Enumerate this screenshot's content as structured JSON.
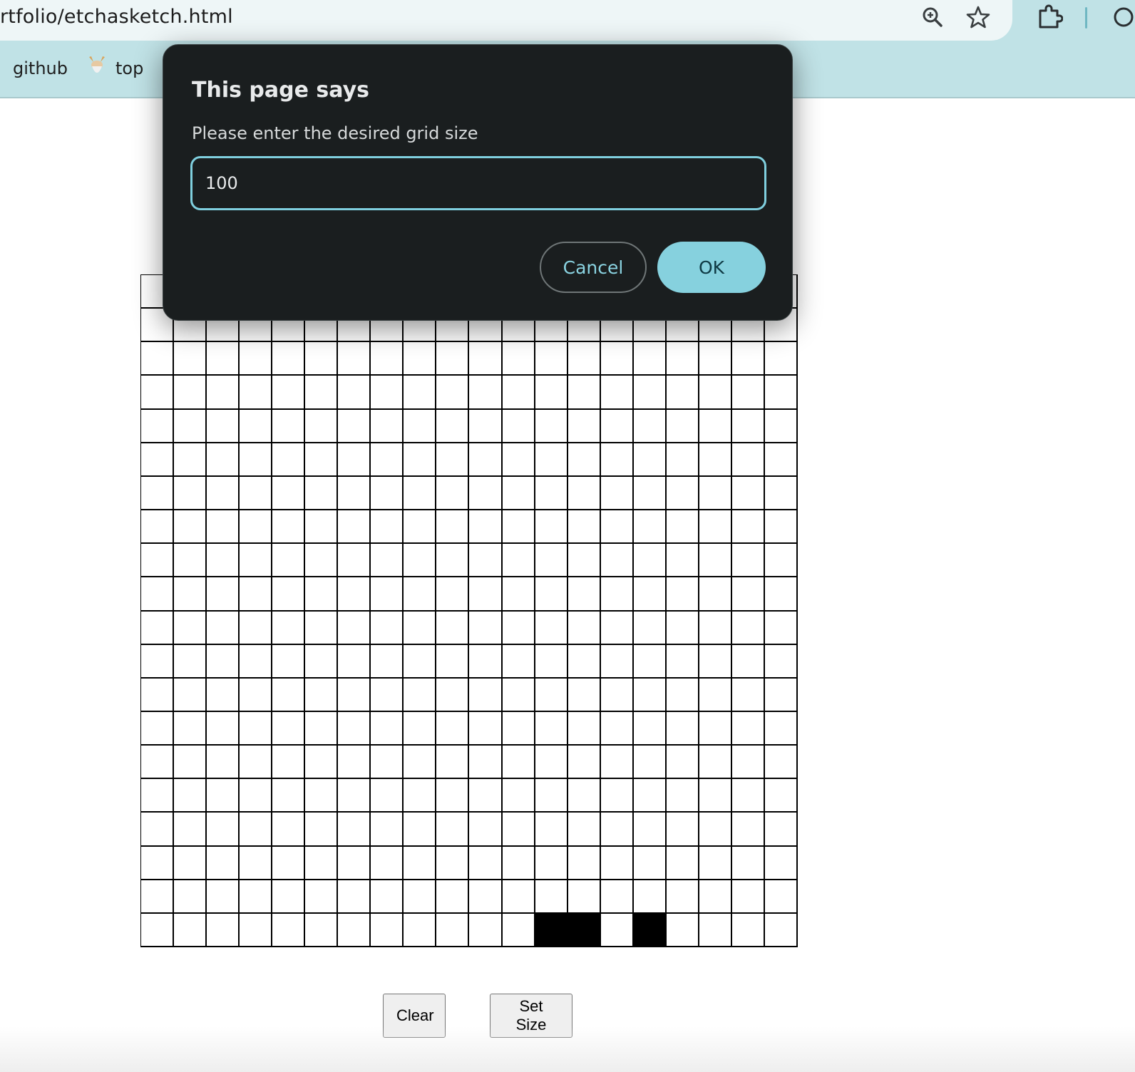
{
  "browser": {
    "url": "rtfolio/etchasketch.html",
    "icons": {
      "zoom": "zoom-magnifier-icon",
      "bookmark": "star-icon",
      "extensions": "puzzle-piece-icon"
    },
    "bookmarks": [
      {
        "label": "github",
        "icon": "github-icon"
      },
      {
        "label": "top",
        "icon": "odin-project-icon"
      }
    ]
  },
  "dialog": {
    "title": "This page says",
    "message": "Please enter the desired grid size",
    "input_value": "100",
    "cancel_label": "Cancel",
    "ok_label": "OK"
  },
  "grid": {
    "rows": 20,
    "cols": 20,
    "filled_cells": [
      [
        19,
        12
      ],
      [
        19,
        13
      ],
      [
        19,
        15
      ]
    ],
    "cell_color": "#ffffff",
    "fill_color": "#000000"
  },
  "controls": {
    "clear_label": "Clear",
    "set_size_label": "Set Size"
  },
  "colors": {
    "chrome_bg": "#c0e2e6",
    "dialog_bg": "#1a1e1f",
    "accent": "#86d1de"
  }
}
